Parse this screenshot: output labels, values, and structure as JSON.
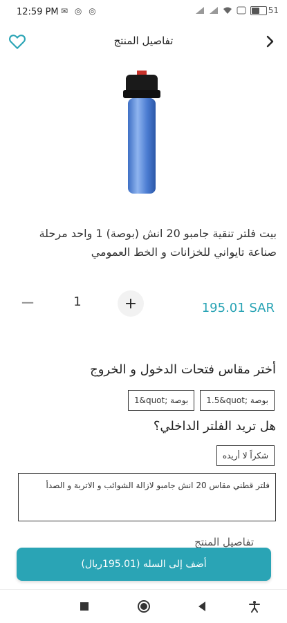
{
  "status_bar": {
    "time": "12:59 PM",
    "notification_icons": [
      "mail-icon",
      "app-icon",
      "app-icon"
    ],
    "battery_text": "51",
    "battery_level": 0.51
  },
  "header": {
    "title": "تفاصيل المنتج",
    "favorite_icon": "heart-icon",
    "back_icon": "chevron-right-icon"
  },
  "product": {
    "title": "بيت فلتر تنقية جامبو 20 انش (بوصة) 1 واحد مرحلة  صناعة تايواني للخزانات و الخط العمومي",
    "price": "195.01 SAR",
    "quantity": "1",
    "minus_label": "−",
    "plus_label": "+"
  },
  "options": {
    "size_title": "أختر مقاس فتحات الدخول و الخروج",
    "size_options": [
      "1.5&quot; بوصة",
      "1&quot; بوصة"
    ],
    "filter_title": "هل تريد الفلتر الداخلي؟",
    "filter_options": [
      "شكراً لا أريده"
    ],
    "filter_description": "فلتر قطني مقاس 20 انش جامبو لازالة الشوائب و الاتربة و الصدأ"
  },
  "details": {
    "title": "تفاصيل المنتج"
  },
  "cart_button": {
    "label": "أضف إلى السله (195.01ريال)"
  },
  "colors": {
    "accent": "#2aa4b5",
    "text": "#222222"
  },
  "nav_bar": {
    "icons": [
      "square-icon",
      "circle-icon",
      "back-triangle-icon",
      "accessibility-icon"
    ]
  }
}
